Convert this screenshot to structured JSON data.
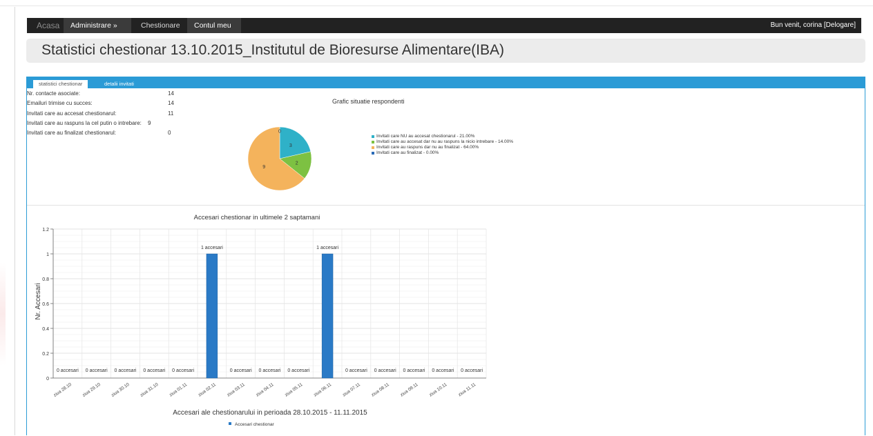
{
  "nav": {
    "brand": "Acasa",
    "items": [
      "Administrare »",
      "Chestionare",
      "Contul meu"
    ],
    "welcome": "Bun venit, corina [Delogare]"
  },
  "page_title": "Statistici chestionar 13.10.2015_Institutul de Bioresurse Alimentare(IBA)",
  "tabs": [
    "statistici chestionar",
    "detalii invitati"
  ],
  "stats": [
    {
      "label": "Nr. contacte asociate:",
      "value": "14"
    },
    {
      "label": "Emailuri trimise cu succes:",
      "value": "14"
    },
    {
      "label": "Invitati care au accesat chestionarul:",
      "value": "11"
    },
    {
      "label": "Invitati care au raspuns la cel putin o intrebare:",
      "value": "9"
    },
    {
      "label": "Invitati care au finalizat chestionarul:",
      "value": "0"
    }
  ],
  "chart_data": [
    {
      "type": "pie",
      "title": "Grafic situatie respondenti",
      "slices": [
        {
          "label": "Invitati care NU au accesat chestionarul - 21.00%",
          "value": 3,
          "color": "#2fb1c8"
        },
        {
          "label": "Invitati care au accesat dar nu au raspuns la nicio intrebare - 14.00%",
          "value": 2,
          "color": "#7dc142"
        },
        {
          "label": "Invitati care au raspuns dar nu au finalizat - 64.00%",
          "value": 9,
          "color": "#f4b35c"
        },
        {
          "label": "Invitati care au finalizat - 0.00%",
          "value": 0,
          "color": "#2a6ab8"
        }
      ],
      "legend_position": "right"
    },
    {
      "type": "bar",
      "title": "Accesari chestionar in ultimele 2 saptamani",
      "xlabel": "Accesari ale chestionarului in perioada 28.10.2015 - 11.11.2015",
      "ylabel": "Nr. Accesari",
      "categories": [
        "ziua 28.10",
        "ziua 29.10",
        "ziua 30.10",
        "ziua 31.10",
        "ziua 01.11",
        "ziua 02.11",
        "ziua 03.11",
        "ziua 04.11",
        "ziua 05.11",
        "ziua 06.11",
        "ziua 07.11",
        "ziua 08.11",
        "ziua 09.11",
        "ziua 10.11",
        "ziua 11.11"
      ],
      "series": [
        {
          "name": "Accesari chestionar",
          "values": [
            0,
            0,
            0,
            0,
            0,
            1,
            0,
            0,
            0,
            1,
            0,
            0,
            0,
            0,
            0
          ],
          "color": "#2a7ac6"
        }
      ],
      "data_labels": [
        "0 accesari",
        "0 accesari",
        "0 accesari",
        "0 accesari",
        "0 accesari",
        "1 accesari",
        "0 accesari",
        "0 accesari",
        "0 accesari",
        "1 accesari",
        "0 accesari",
        "0 accesari",
        "0 accesari",
        "0 accesari",
        "0 accesari"
      ],
      "ylim": [
        0,
        1.2
      ],
      "yticks": [
        "0",
        "0.2",
        "0.4",
        "0.6",
        "0.8",
        "1",
        "1.2"
      ],
      "grid": true,
      "legend_position": "bottom"
    }
  ]
}
